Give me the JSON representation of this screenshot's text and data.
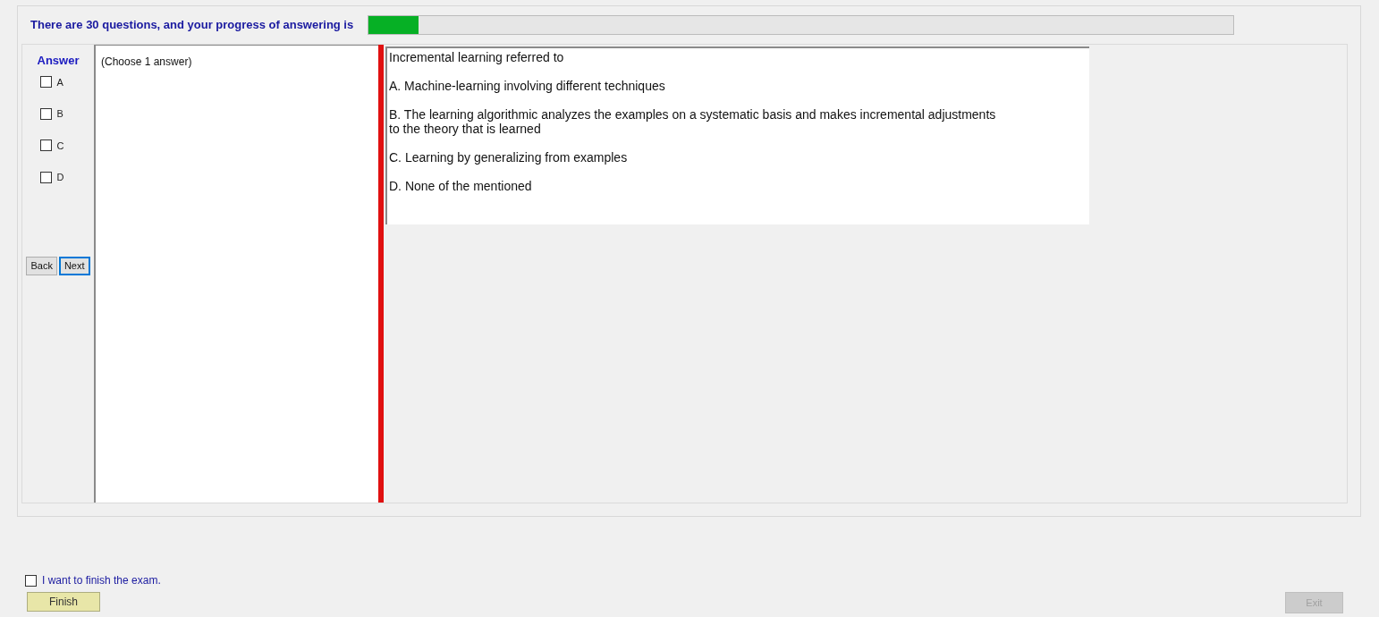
{
  "header": {
    "text": "There are 30 questions, and your progress of answering is",
    "progress": {
      "level": 0.058
    }
  },
  "answer_panel": {
    "title": "Answer",
    "options": [
      {
        "label": "A",
        "checked": false
      },
      {
        "label": "B",
        "checked": false
      },
      {
        "label": "C",
        "checked": false
      },
      {
        "label": "D",
        "checked": false
      }
    ],
    "buttons": [
      {
        "label": "Back",
        "selected": false
      },
      {
        "label": "Next",
        "selected": true
      }
    ]
  },
  "hint": "(Choose 1 answer)",
  "question": {
    "stem": "Incremental learning referred to",
    "choices": [
      "A.  Machine-learning involving different techniques",
      "B.  The learning algorithmic analyzes the examples on a systematic basis and makes incremental adjustments\nto the theory that is learned",
      "C.  Learning by generalizing from examples",
      "D.  None of the mentioned"
    ]
  },
  "finish": {
    "label": "I want to finish the exam.",
    "checked": false,
    "button": "Finish",
    "button_disabled": false
  },
  "exit": {
    "label": "Exit",
    "disabled": true
  }
}
